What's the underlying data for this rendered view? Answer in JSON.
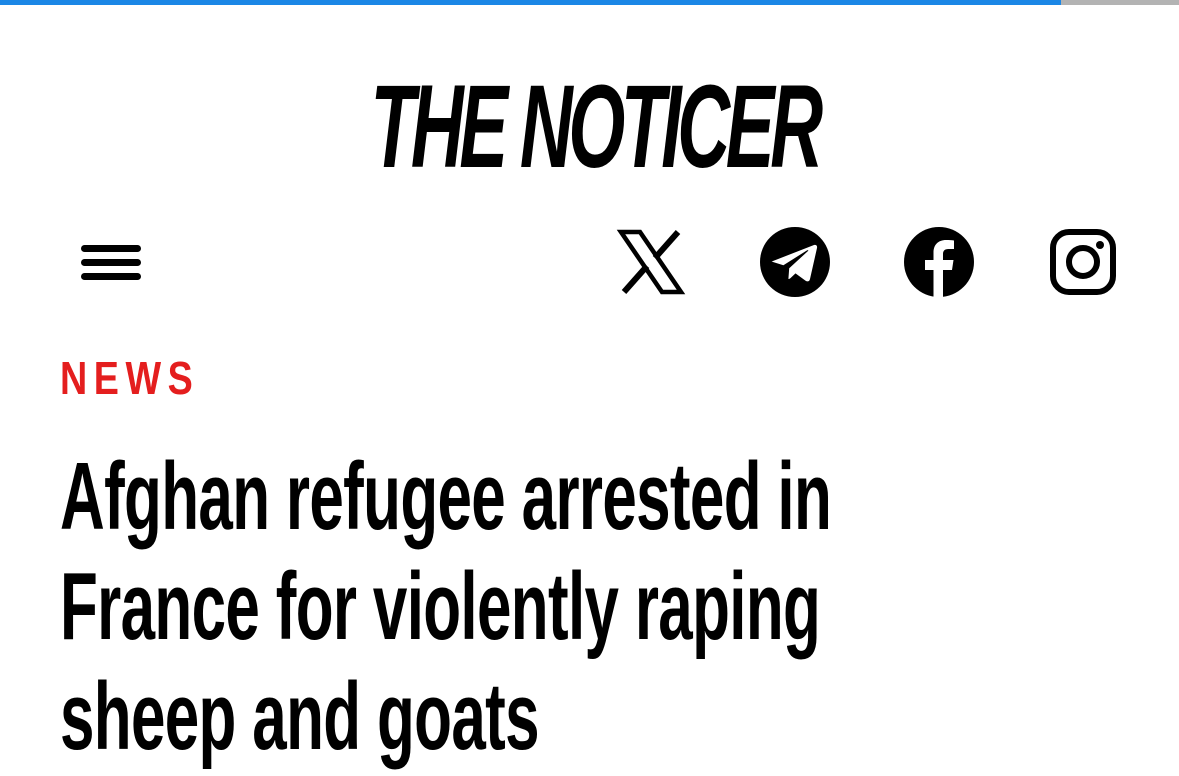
{
  "progress": {
    "fraction": 0.9
  },
  "header": {
    "logo_text": "THE NOTICER"
  },
  "toolbar": {
    "menu_icon": "hamburger-menu-icon",
    "social_links": [
      {
        "name": "X",
        "icon": "x-icon"
      },
      {
        "name": "Telegram",
        "icon": "telegram-icon"
      },
      {
        "name": "Facebook",
        "icon": "facebook-icon"
      },
      {
        "name": "Instagram",
        "icon": "instagram-icon"
      }
    ]
  },
  "article": {
    "category": "NEWS",
    "headline_lines": [
      "Afghan refugee arrested in",
      "France for violently raping",
      "sheep and goats"
    ]
  },
  "colors": {
    "progress": "#1b87e6",
    "progress_track": "#b3b3b3",
    "category": "#e41e1e",
    "text": "#000000",
    "background": "#ffffff"
  }
}
